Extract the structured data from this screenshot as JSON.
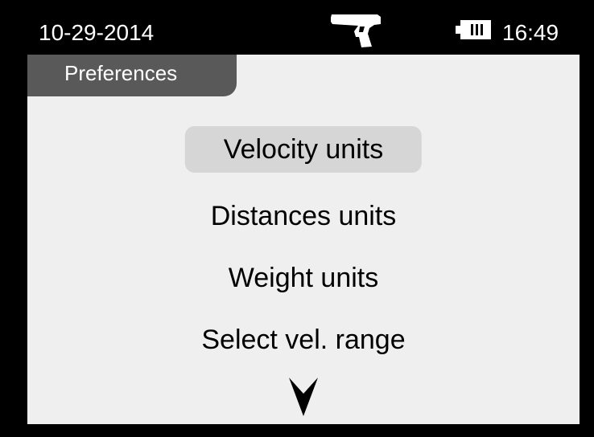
{
  "status_bar": {
    "date": "10-29-2014",
    "time": "16:49",
    "mode_icon": "pistol-icon",
    "battery_icon": "battery-icon"
  },
  "header": {
    "title": "Preferences"
  },
  "menu": {
    "items": [
      {
        "label": "Velocity units",
        "selected": true
      },
      {
        "label": "Distances units",
        "selected": false
      },
      {
        "label": "Weight units",
        "selected": false
      },
      {
        "label": "Select vel. range",
        "selected": false
      }
    ],
    "more_indicator": "chevron-down-icon"
  },
  "colors": {
    "background": "#000000",
    "screen": "#efefef",
    "header_tab": "#595959",
    "selection": "#d6d6d6",
    "text": "#000000"
  }
}
